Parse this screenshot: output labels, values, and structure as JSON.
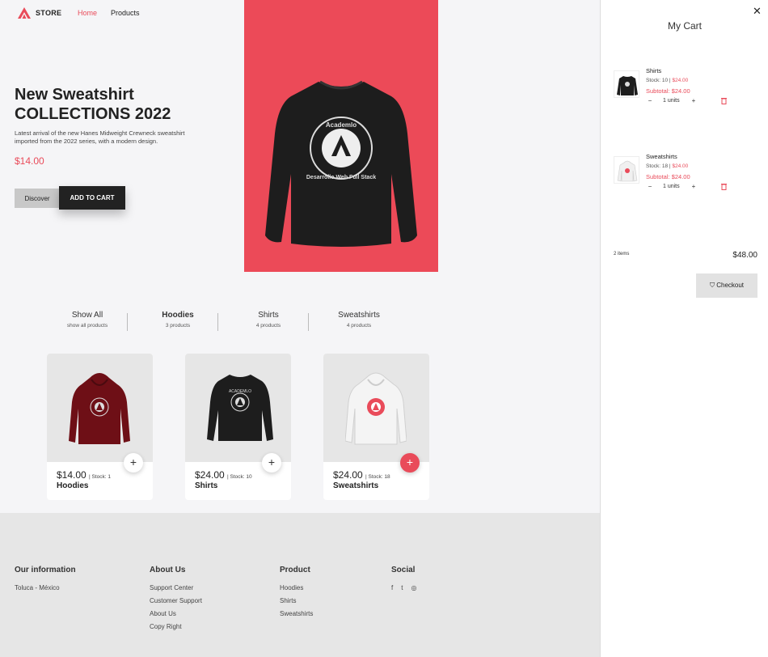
{
  "header": {
    "brand": "STORE",
    "nav": {
      "home": "Home",
      "products": "Products"
    },
    "cart_count": "2",
    "accent_color": "#e94b5a"
  },
  "hero": {
    "title": "New Sweatshirt COLLECTIONS 2022",
    "description": "Latest arrival of the new Hanes Midweight Crewneck sweatshirt imported from the 2022 series, with a modern design.",
    "price": "$14.00",
    "discover_label": "Discover",
    "add_label": "ADD TO CART",
    "image_bg": "#ec4a58"
  },
  "filters": [
    {
      "name": "Show All",
      "sub": "show all products"
    },
    {
      "name": "Hoodies",
      "sub": "3 products"
    },
    {
      "name": "Shirts",
      "sub": "4 products"
    },
    {
      "name": "Sweatshirts",
      "sub": "4 products"
    }
  ],
  "products": [
    {
      "price": "$14.00",
      "stock": "| Stock: 1",
      "name": "Hoodies",
      "color": "#6e0f16"
    },
    {
      "price": "$24.00",
      "stock": "| Stock: 10",
      "name": "Shirts",
      "color": "#1e1e1e"
    },
    {
      "price": "$24.00",
      "stock": "| Stock: 18",
      "name": "Sweatshirts",
      "color": "#e8e8e8"
    }
  ],
  "footer": {
    "info": {
      "heading": "Our information",
      "location": "Toluca - México"
    },
    "about": {
      "heading": "About Us",
      "links": [
        "Support Center",
        "Customer Support",
        "About Us",
        "Copy Right"
      ]
    },
    "product": {
      "heading": "Product",
      "links": [
        "Hoodies",
        "Shirts",
        "Sweatshirts"
      ]
    },
    "social": {
      "heading": "Social",
      "icons": [
        "facebook-icon",
        "twitter-icon",
        "instagram-icon"
      ],
      "glyphs": [
        "f",
        "t",
        "◎"
      ]
    }
  },
  "cart": {
    "title": "My Cart",
    "items": [
      {
        "name": "Shirts",
        "stock_label": "Stock: 10 |",
        "unit_price": "$24.00",
        "subtotal": "Subtotal: $24.00",
        "qty": "1 units"
      },
      {
        "name": "Sweatshirts",
        "stock_label": "Stock: 18 |",
        "unit_price": "$24.00",
        "subtotal": "Subtotal: $24.00",
        "qty": "1 units"
      }
    ],
    "count_label": "2 items",
    "total": "$48.00",
    "checkout_label": "Checkout"
  }
}
